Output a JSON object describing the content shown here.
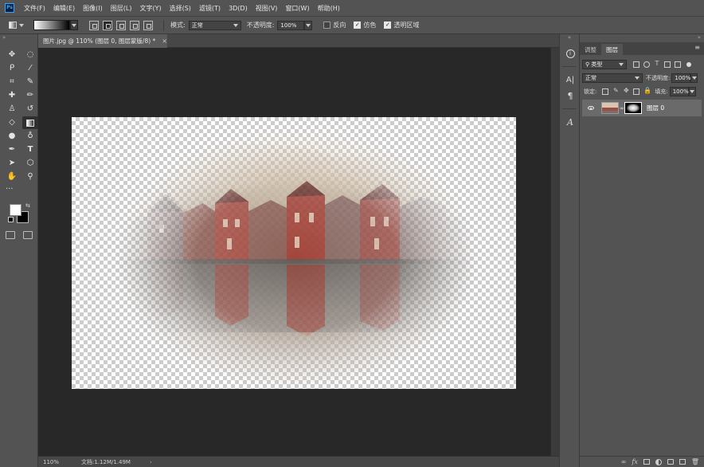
{
  "app": {
    "logo": "Ps"
  },
  "menu": [
    "文件(F)",
    "编辑(E)",
    "图像(I)",
    "图层(L)",
    "文字(Y)",
    "选择(S)",
    "滤镜(T)",
    "3D(D)",
    "视图(V)",
    "窗口(W)",
    "帮助(H)"
  ],
  "options": {
    "mode_label": "模式:",
    "mode_value": "正常",
    "opacity_label": "不透明度:",
    "opacity_value": "100%",
    "reverse_label": "反向",
    "reverse_checked": false,
    "dither_label": "仿色",
    "dither_checked": true,
    "transparency_label": "透明区域",
    "transparency_checked": true
  },
  "document": {
    "tab_title": "图片.jpg @ 110% (图层 0, 图层蒙版/8) *",
    "tab_close": "×",
    "zoom": "110%",
    "doc_info": "文档:1.12M/1.49M",
    "status_arrow": "›"
  },
  "layers_panel": {
    "tabs": [
      "调整",
      "图层"
    ],
    "active_tab": 1,
    "menu_icon": "≡",
    "filter_kind": "类型",
    "blend_mode": "正常",
    "opacity_label": "不透明度:",
    "opacity_value": "100%",
    "lock_label": "锁定:",
    "fill_label": "填充:",
    "fill_value": "100%",
    "layers": [
      {
        "name": "图层 0",
        "visible": true,
        "has_mask": true
      }
    ]
  },
  "colors": {
    "accent": "#31a8ff",
    "foreground": "#ffffff",
    "background": "#000000",
    "canvas_bg": "#282828"
  },
  "icons": {
    "left_tools": [
      "move-icon",
      "marquee-icon",
      "lasso-icon",
      "magic-wand-icon",
      "crop-icon",
      "eyedropper-icon",
      "healing-brush-icon",
      "brush-icon",
      "clone-stamp-icon",
      "history-brush-icon",
      "eraser-icon",
      "gradient-icon",
      "blur-icon",
      "dodge-icon",
      "pen-icon",
      "type-icon",
      "path-select-icon",
      "shape-icon",
      "hand-icon",
      "zoom-icon"
    ],
    "active_tool": "gradient-icon"
  }
}
